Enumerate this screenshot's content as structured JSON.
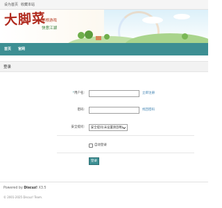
{
  "topbar": {
    "set_homepage": "设为首页",
    "bookmark": "收藏本站"
  },
  "logo": {
    "main": "大脚菜",
    "sub_line1": "草根游戏",
    "sub_line2": "快意江湖"
  },
  "nav": {
    "items": [
      {
        "label": "首页"
      },
      {
        "label": "官网"
      }
    ]
  },
  "section": {
    "title": "登录"
  },
  "form": {
    "username": {
      "required_mark": "*",
      "label": "用户名:",
      "value": "",
      "aside_link": "立即注册"
    },
    "password": {
      "label": "密码:",
      "value": "",
      "aside_link": "找回密码"
    },
    "security": {
      "label": "安全提问:",
      "selected": "安全提问(未设置请忽略)"
    },
    "remember": {
      "label": "自动登录",
      "checked": false
    },
    "submit_label": "登录"
  },
  "footer": {
    "powered_prefix": "Powered by ",
    "product": "Discuz!",
    "version": " X3.5",
    "copyright": "© 2001-2025 Discuz! Team."
  },
  "colors": {
    "nav_bg": "#3d8f93",
    "logo_red": "#b02a1e",
    "link_blue": "#3a7fb0"
  }
}
